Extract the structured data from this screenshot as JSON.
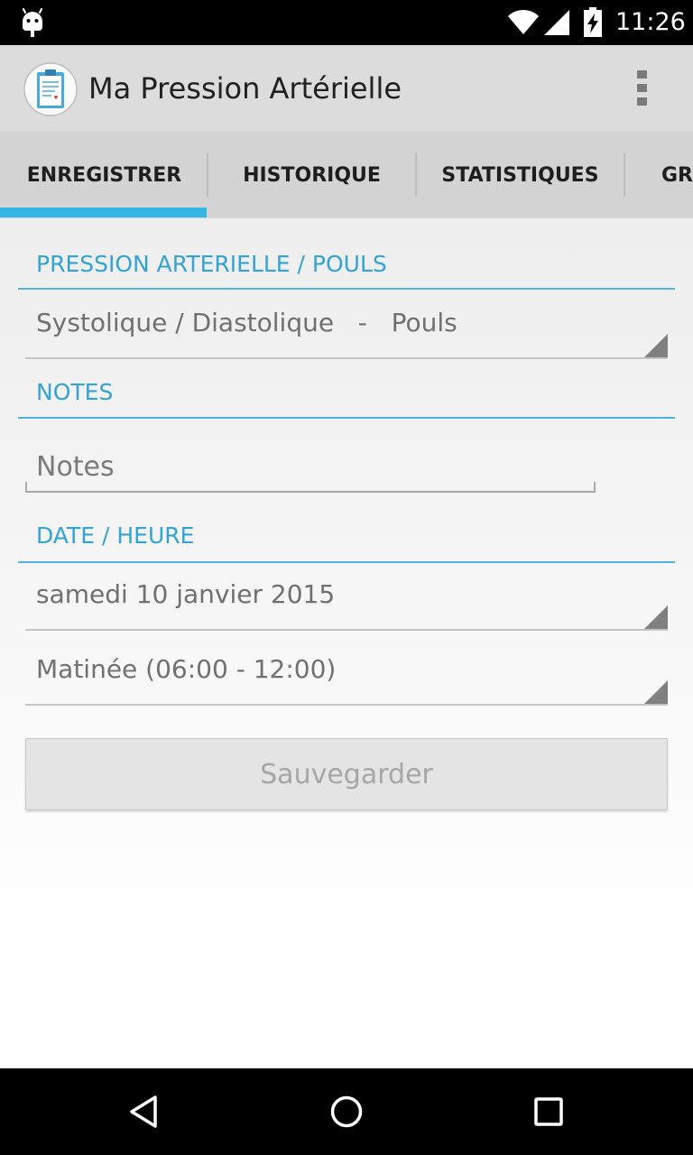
{
  "status_bar": {
    "time": "11:26",
    "icons": [
      "android-icon",
      "wifi-icon",
      "signal-icon",
      "battery-charging-icon"
    ]
  },
  "action_bar": {
    "title": "Ma Pression Artérielle",
    "app_icon": "clipboard-heart-icon",
    "overflow_icon": "overflow-menu-icon"
  },
  "tabs": [
    {
      "label": "ENREGISTRER",
      "selected": true
    },
    {
      "label": "HISTORIQUE",
      "selected": false
    },
    {
      "label": "STATISTIQUES",
      "selected": false
    },
    {
      "label": "GRA",
      "selected": false
    }
  ],
  "form": {
    "bp_section": {
      "header": "PRESSION ARTERIELLE / POULS",
      "spinner_value": "Systolique / Diastolique   -   Pouls"
    },
    "notes_section": {
      "header": "NOTES",
      "placeholder": "Notes",
      "value": ""
    },
    "datetime_section": {
      "header": "DATE / HEURE",
      "date_value": "samedi 10 janvier 2015",
      "time_period_value": "Matinée (06:00 - 12:00)"
    },
    "save_label": "Sauvegarder"
  },
  "nav_bar": {
    "icons": [
      "back-icon",
      "home-icon",
      "recents-icon"
    ]
  },
  "colors": {
    "accent": "#33b5e5",
    "section_header": "#33a3d6",
    "action_bar": "#dcdcdc",
    "tab_bar": "#d3d3d3"
  }
}
